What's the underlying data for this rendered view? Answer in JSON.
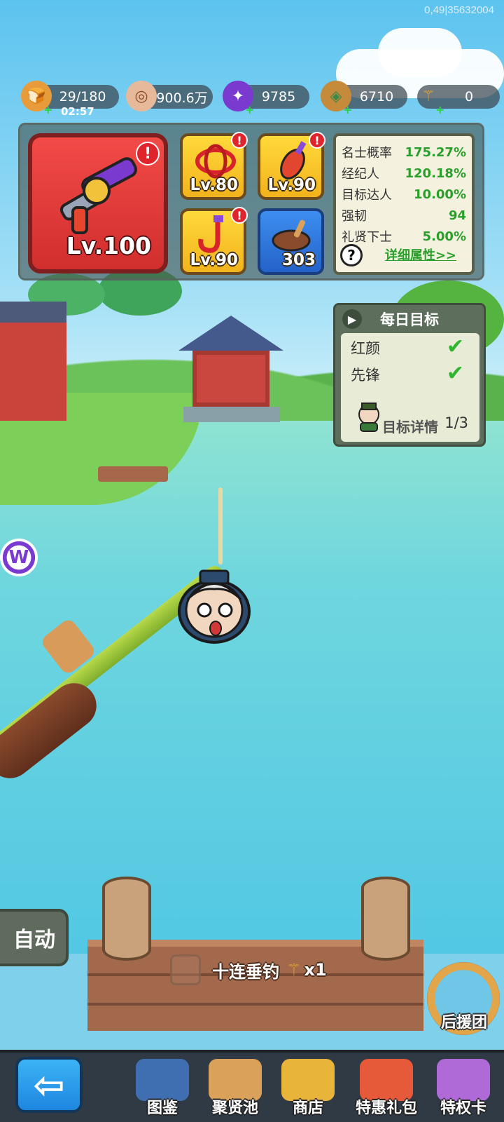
{
  "debug_text": "0,49|35632004",
  "resources": [
    {
      "name": "stamina",
      "value": "29/180",
      "icon": "bread-icon",
      "has_plus": true
    },
    {
      "name": "coins",
      "value": "900.6万",
      "icon": "coin-icon",
      "has_plus": false
    },
    {
      "name": "gems",
      "value": "9785",
      "icon": "purple-gem-icon",
      "has_plus": true
    },
    {
      "name": "tokens",
      "value": "6710",
      "icon": "jade-token-icon",
      "has_plus": true
    },
    {
      "name": "bait",
      "value": "0",
      "icon": "trident-icon",
      "has_plus": true
    }
  ],
  "stamina_timer": "02:57",
  "equipment": {
    "main": {
      "name": "fishing-reel",
      "level": "Lv.100",
      "alert": "!"
    },
    "slots": [
      {
        "name": "red-fishing-line",
        "level": "Lv.80",
        "alert": "!"
      },
      {
        "name": "float-bobber",
        "level": "Lv.90",
        "alert": "!"
      },
      {
        "name": "fish-hook",
        "level": "Lv.90",
        "alert": "!"
      },
      {
        "name": "bait-pot",
        "level": "303",
        "alert": ""
      }
    ]
  },
  "stats": {
    "rows": [
      {
        "name": "名士概率",
        "value": "175.27%"
      },
      {
        "name": "经纪人",
        "value": "120.18%"
      },
      {
        "name": "目标达人",
        "value": "10.00%"
      },
      {
        "name": "强韧",
        "value": "94"
      },
      {
        "name": "礼贤下士",
        "value": "5.00%"
      }
    ],
    "help": "?",
    "detail_link": "详细属性>>"
  },
  "daily_goals": {
    "title": "每日目标",
    "arrow": "▶",
    "items": [
      {
        "label": "红颜",
        "done": "✔"
      },
      {
        "label": "先锋",
        "done": "✔"
      }
    ],
    "progress": "1/3",
    "detail": "目标详情"
  },
  "side_badge": "W",
  "controls": {
    "auto": "自动",
    "ten_cast": "十连垂钓",
    "ten_cast_count": "x1",
    "support": "后援团"
  },
  "nav": {
    "back": "⇦",
    "items": [
      {
        "label": "图鉴",
        "icon": "book-icon",
        "color": "#3f6fb0"
      },
      {
        "label": "聚贤池",
        "icon": "map-scroll-icon",
        "color": "#d9a15a"
      },
      {
        "label": "商店",
        "icon": "treasure-bowl-icon",
        "color": "#e9b43a"
      },
      {
        "label": "特惠礼包",
        "icon": "gift-pack-icon",
        "color": "#e65a3a"
      },
      {
        "label": "特权卡",
        "icon": "privilege-card-icon",
        "color": "#b06ad8"
      }
    ]
  },
  "colors": {
    "accent_green": "#2aa02c",
    "alert_red": "#e0242c",
    "main_slot_red": "#f24a47",
    "slot_yellow": "#ffd93a",
    "slot_blue": "#3d8ef0"
  }
}
